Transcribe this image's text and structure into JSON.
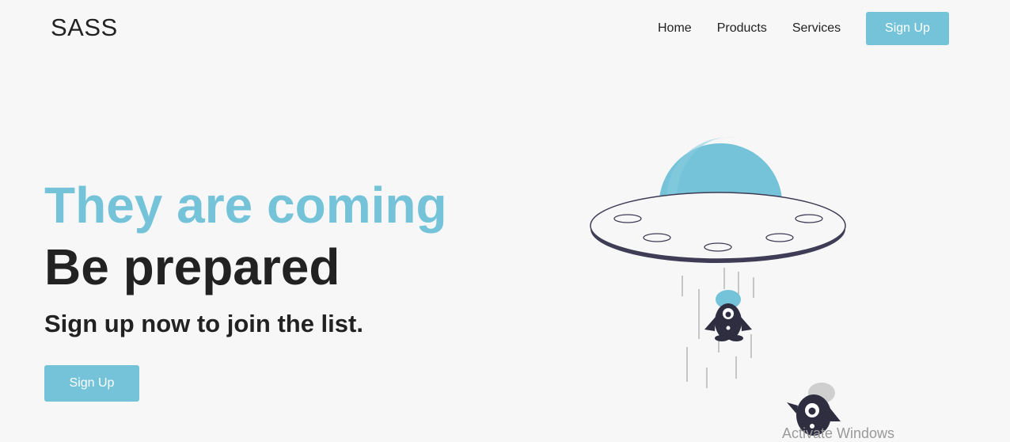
{
  "header": {
    "logo": "SASS",
    "nav": [
      "Home",
      "Products",
      "Services"
    ],
    "signup_label": "Sign Up"
  },
  "hero": {
    "line1": "They are coming",
    "line2": "Be prepared",
    "subtitle": "Sign up now to join the list.",
    "signup_label": "Sign Up"
  },
  "watermark": "Activate Windows",
  "colors": {
    "accent": "#74c3d9",
    "text": "#222222",
    "background": "#f7f7f7",
    "ufo_dark": "#3f3d56"
  }
}
